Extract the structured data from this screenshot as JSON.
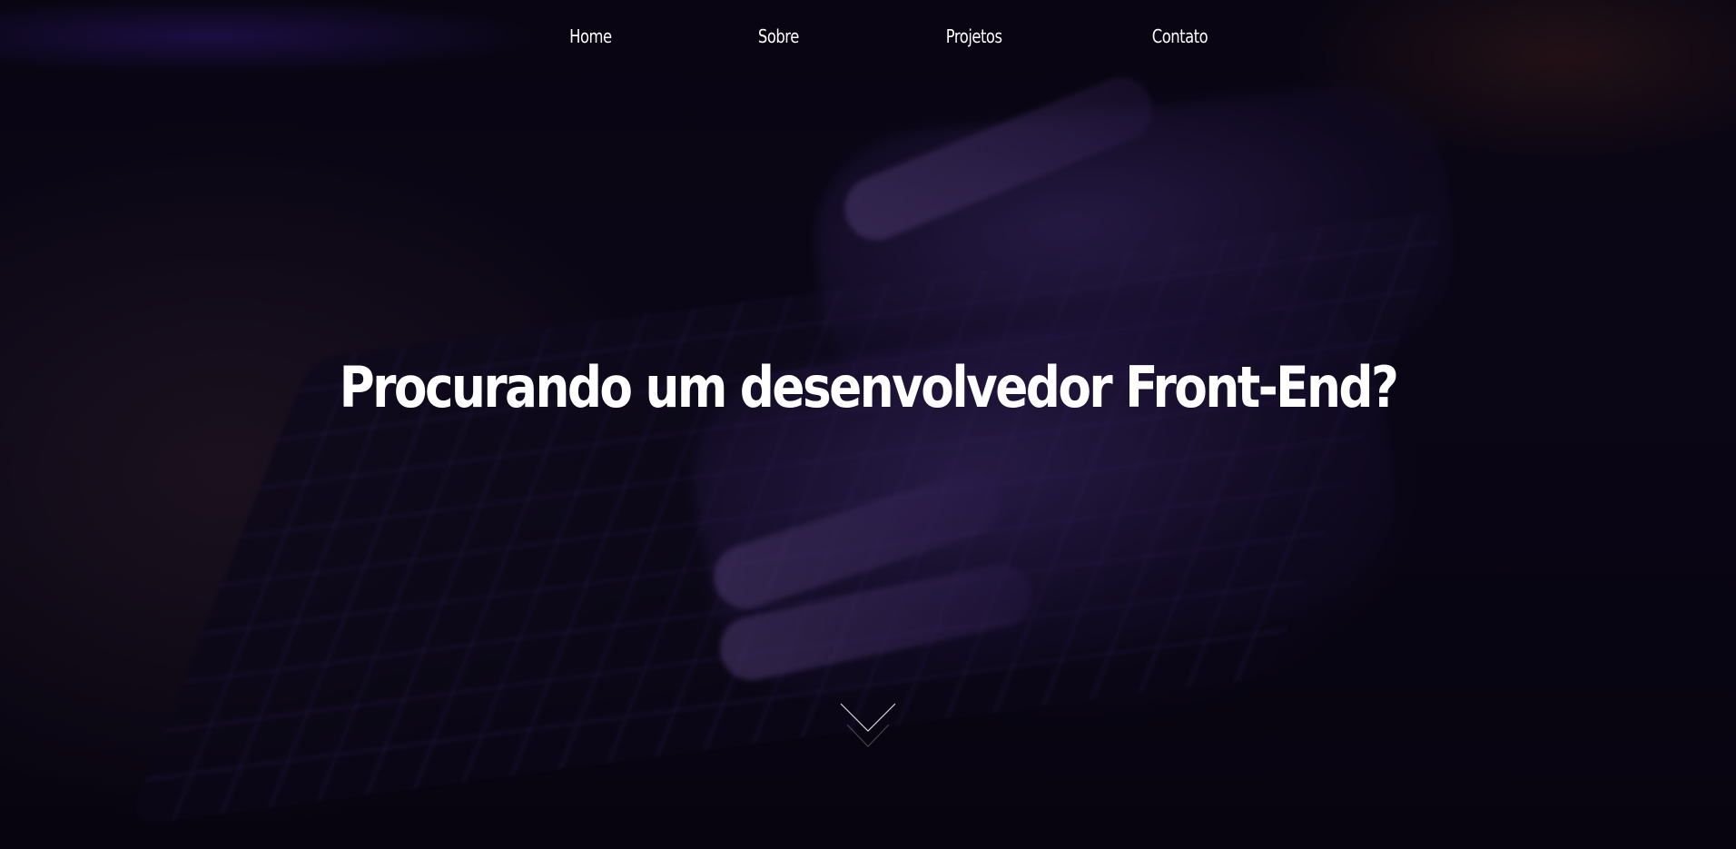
{
  "nav": {
    "items": [
      {
        "label": "Home"
      },
      {
        "label": "Sobre"
      },
      {
        "label": "Projetos"
      },
      {
        "label": "Contato"
      }
    ]
  },
  "hero": {
    "headline": "Procurando um desenvolvedor Front-End?",
    "scroll_icon": "chevron-down-icon"
  },
  "colors": {
    "text": "#ffffff",
    "accent": "#4b2aa8",
    "background": "#06040c"
  }
}
